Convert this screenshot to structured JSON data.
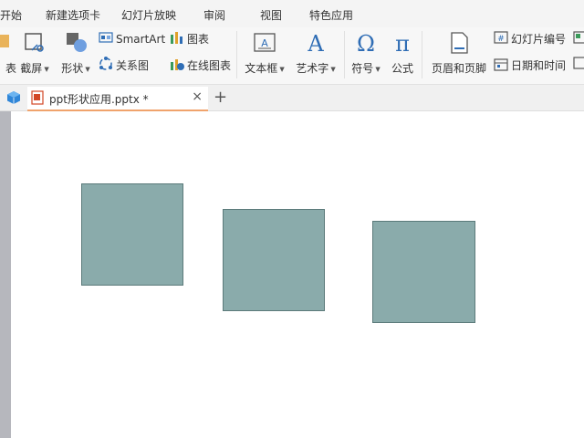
{
  "menubar": {
    "items": [
      "开始",
      "新建选项卡",
      "幻灯片放映",
      "审阅",
      "视图",
      "特色应用"
    ]
  },
  "ribbon": {
    "partial_left_label": "表",
    "screenshot_label": "截屏",
    "shape_label": "形状",
    "smartart_label": "SmartArt",
    "chart_label": "图表",
    "relation_label": "关系图",
    "online_chart_label": "在线图表",
    "textbox_label": "文本框",
    "wordart_label": "艺术字",
    "symbol_label": "符号",
    "formula_label": "公式",
    "header_footer_label": "页眉和页脚",
    "slide_number_label": "幻灯片编号",
    "datetime_label": "日期和时间"
  },
  "tabs": {
    "document_name": "ppt形状应用.pptx *",
    "close_glyph": "×",
    "new_tab_glyph": "+"
  },
  "colors": {
    "shape_fill": "#8aabab",
    "shape_border": "#5b7a7a",
    "tab_accent": "#f0a36c",
    "icon_blue": "#2f6db5"
  },
  "slide": {
    "shapes": [
      {
        "kind": "square"
      },
      {
        "kind": "square"
      },
      {
        "kind": "square"
      }
    ]
  }
}
